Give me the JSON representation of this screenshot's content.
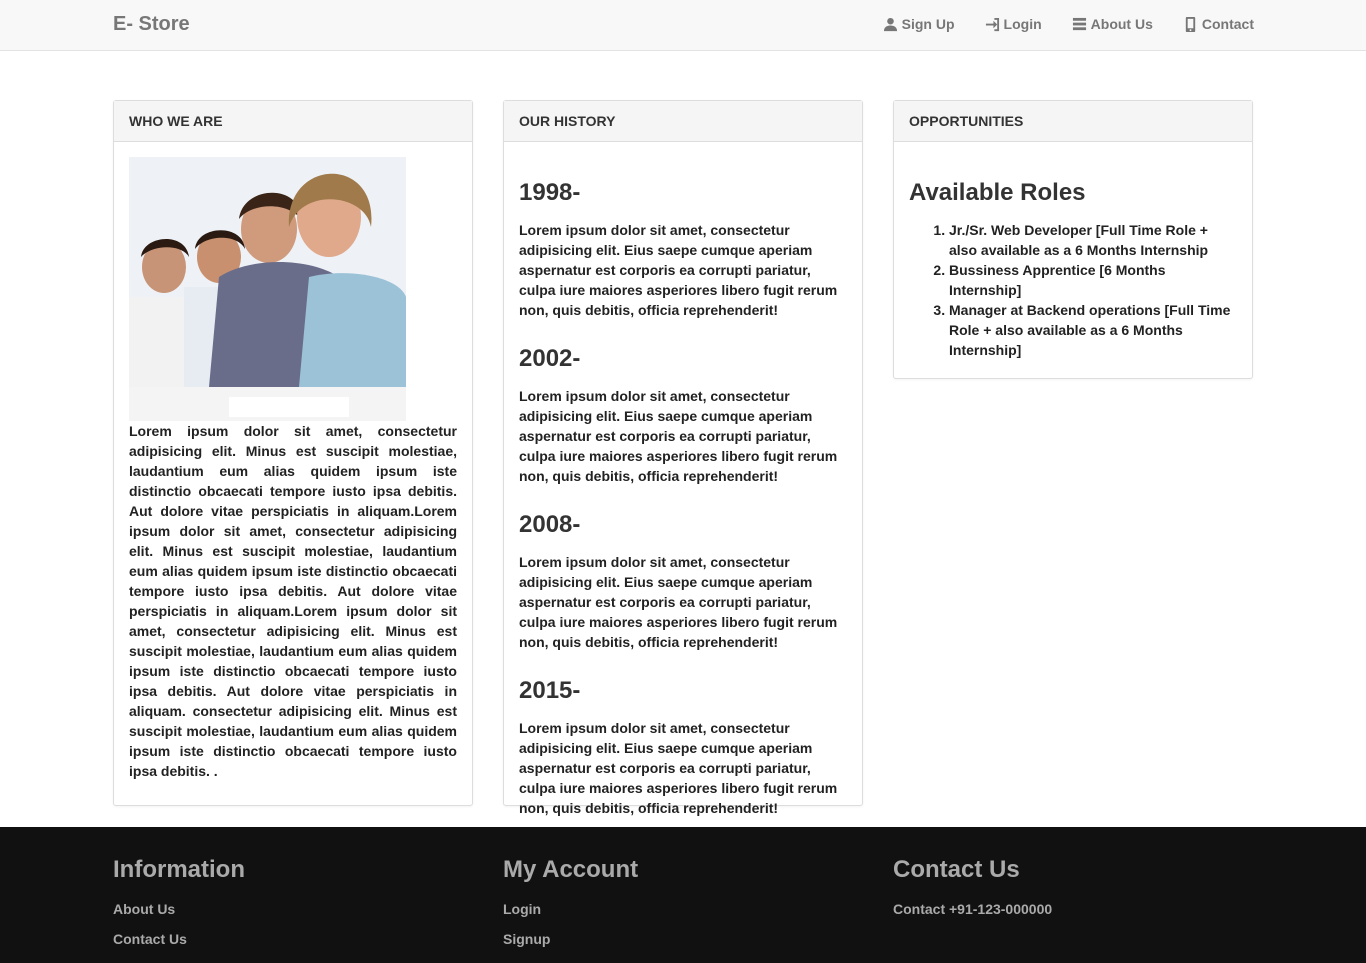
{
  "navbar": {
    "brand": "E- Store",
    "links": [
      {
        "label": "Sign Up",
        "icon": "user-icon"
      },
      {
        "label": "Login",
        "icon": "login-icon"
      },
      {
        "label": "About Us",
        "icon": "list-icon"
      },
      {
        "label": "Contact",
        "icon": "phone-icon"
      }
    ]
  },
  "who_we_are": {
    "heading": "WHO WE ARE",
    "text": "Lorem ipsum dolor sit amet, consectetur adipisicing elit. Minus est suscipit molestiae, laudantium eum alias quidem ipsum iste distinctio obcaecati tempore iusto ipsa debitis. Aut dolore vitae perspiciatis in aliquam.Lorem ipsum dolor sit amet, consectetur adipisicing elit. Minus est suscipit molestiae, laudantium eum alias quidem ipsum iste distinctio obcaecati tempore iusto ipsa debitis. Aut dolore vitae perspiciatis in aliquam.Lorem ipsum dolor sit amet, consectetur adipisicing elit. Minus est suscipit molestiae, laudantium eum alias quidem ipsum iste distinctio obcaecati tempore iusto ipsa debitis. Aut dolore vitae perspiciatis in aliquam. consectetur adipisicing elit. Minus est suscipit molestiae, laudantium eum alias quidem ipsum iste distinctio obcaecati tempore iusto ipsa debitis. ."
  },
  "history": {
    "heading": "OUR HISTORY",
    "entries": [
      {
        "year": "1998-",
        "text": "Lorem ipsum dolor sit amet, consectetur adipisicing elit. Eius saepe cumque aperiam aspernatur est corporis ea corrupti pariatur, culpa iure maiores asperiores libero fugit rerum non, quis debitis, officia reprehenderit!"
      },
      {
        "year": "2002-",
        "text": "Lorem ipsum dolor sit amet, consectetur adipisicing elit. Eius saepe cumque aperiam aspernatur est corporis ea corrupti pariatur, culpa iure maiores asperiores libero fugit rerum non, quis debitis, officia reprehenderit!"
      },
      {
        "year": "2008-",
        "text": "Lorem ipsum dolor sit amet, consectetur adipisicing elit. Eius saepe cumque aperiam aspernatur est corporis ea corrupti pariatur, culpa iure maiores asperiores libero fugit rerum non, quis debitis, officia reprehenderit!"
      },
      {
        "year": "2015-",
        "text": "Lorem ipsum dolor sit amet, consectetur adipisicing elit. Eius saepe cumque aperiam aspernatur est corporis ea corrupti pariatur, culpa iure maiores asperiores libero fugit rerum non, quis debitis, officia reprehenderit!"
      }
    ]
  },
  "opportunities": {
    "heading": "OPPORTUNITIES",
    "title": "Available Roles",
    "roles": [
      "Jr./Sr. Web Developer [Full Time Role + also available as a 6 Months Internship",
      "Bussiness Apprentice [6 Months Internship]",
      "Manager at Backend operations [Full Time Role + also available as a 6 Months Internship]"
    ]
  },
  "footer": {
    "information": {
      "title": "Information",
      "links": [
        "About Us",
        "Contact Us"
      ]
    },
    "account": {
      "title": "My Account",
      "links": [
        "Login",
        "Signup"
      ]
    },
    "contact": {
      "title": "Contact Us",
      "text": "Contact +91-123-000000"
    }
  }
}
